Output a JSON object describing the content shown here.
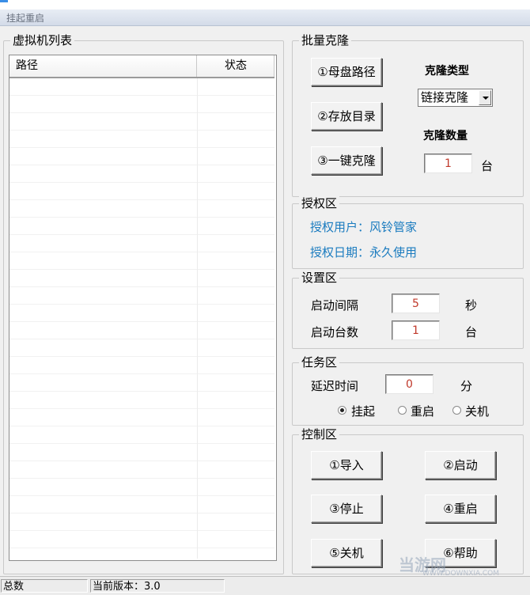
{
  "window": {
    "title": "挂起重启"
  },
  "vm_list": {
    "legend": "虚拟机列表",
    "columns": [
      "路径",
      "状态"
    ],
    "rows": []
  },
  "batch_clone": {
    "legend": "批量克隆",
    "btn_master_path": "①母盘路径",
    "btn_storage_dir": "②存放目录",
    "btn_one_click": "③一键克隆",
    "clone_type_label": "克隆类型",
    "clone_type_value": "链接克隆",
    "clone_count_label": "克隆数量",
    "clone_count_value": "1",
    "unit_tai": "台"
  },
  "auth": {
    "legend": "授权区",
    "user": "授权用户：风铃管家",
    "date": "授权日期：永久使用"
  },
  "settings": {
    "legend": "设置区",
    "interval_label": "启动间隔",
    "interval_value": "5",
    "interval_unit": "秒",
    "count_label": "启动台数",
    "count_value": "1",
    "count_unit": "台"
  },
  "task": {
    "legend": "任务区",
    "delay_label": "延迟时间",
    "delay_value": "0",
    "delay_unit": "分",
    "options": [
      "挂起",
      "重启",
      "关机"
    ],
    "selected": "挂起"
  },
  "control": {
    "legend": "控制区",
    "import": "①导入",
    "start": "②启动",
    "stop": "③停止",
    "restart": "④重启",
    "shutdown": "⑤关机",
    "help": "⑥帮助"
  },
  "status_bar": {
    "total": "总数",
    "version": "当前版本：3.0"
  },
  "watermark": {
    "text": "当游网",
    "sub": "WWW.DOWNXIA.COM"
  }
}
